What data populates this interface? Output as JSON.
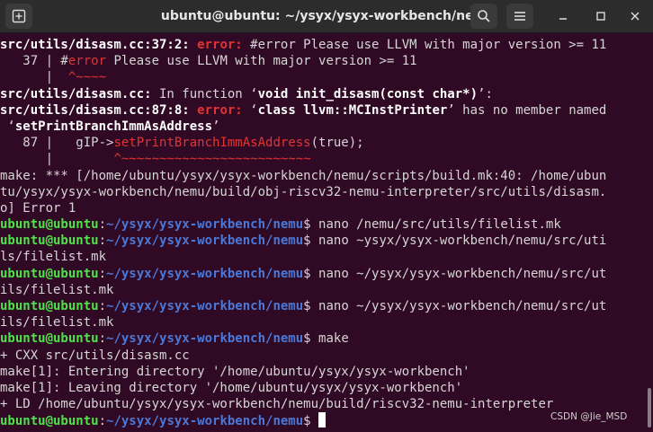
{
  "window": {
    "title": "ubuntu@ubuntu: ~/ysyx/ysyx-workbench/nemu",
    "icons": {
      "new_tab": "new-tab-icon",
      "search": "search-icon",
      "menu": "hamburger-menu-icon",
      "minimize": "minimize-icon",
      "maximize": "maximize-icon",
      "close": "close-icon"
    }
  },
  "colors": {
    "background": "#300a24",
    "error": "#e23434",
    "user": "#4fe34a",
    "path": "#4a78d8",
    "text": "#d6d6d6"
  },
  "terminal": {
    "lines": [
      [
        {
          "t": "src/utils/disasm.cc:37:2: ",
          "c": "b"
        },
        {
          "t": "error: ",
          "c": "err"
        },
        {
          "t": "#error Please use LLVM with major version >= 11",
          "c": ""
        }
      ],
      [
        {
          "t": "   37 | #",
          "c": ""
        },
        {
          "t": "error",
          "c": "errn"
        },
        {
          "t": " Please use LLVM with major version >= 11",
          "c": ""
        }
      ],
      [
        {
          "t": "      |  ",
          "c": ""
        },
        {
          "t": "^~~~~",
          "c": "errn"
        }
      ],
      [
        {
          "t": "src/utils/disasm.cc:",
          "c": "b"
        },
        {
          "t": " In function ‘",
          "c": ""
        },
        {
          "t": "void init_disasm(const char*)",
          "c": "b"
        },
        {
          "t": "’:",
          "c": ""
        }
      ],
      [
        {
          "t": "src/utils/disasm.cc:87:8: ",
          "c": "b"
        },
        {
          "t": "error: ",
          "c": "err"
        },
        {
          "t": "‘",
          "c": ""
        },
        {
          "t": "class llvm::MCInstPrinter",
          "c": "b"
        },
        {
          "t": "’ has no member named",
          "c": ""
        }
      ],
      [
        {
          "t": " ‘",
          "c": ""
        },
        {
          "t": "setPrintBranchImmAsAddress",
          "c": "b"
        },
        {
          "t": "’",
          "c": ""
        }
      ],
      [
        {
          "t": "   87 |   gIP->",
          "c": ""
        },
        {
          "t": "setPrintBranchImmAsAddress",
          "c": "errn"
        },
        {
          "t": "(true);",
          "c": ""
        }
      ],
      [
        {
          "t": "      |        ",
          "c": ""
        },
        {
          "t": "^~~~~~~~~~~~~~~~~~~~~~~~~~",
          "c": "errn"
        }
      ],
      [
        {
          "t": "make: *** [/home/ubuntu/ysyx/ysyx-workbench/nemu/scripts/build.mk:40: /home/ubun",
          "c": ""
        }
      ],
      [
        {
          "t": "tu/ysyx/ysyx-workbench/nemu/build/obj-riscv32-nemu-interpreter/src/utils/disasm.",
          "c": ""
        }
      ],
      [
        {
          "t": "o] Error 1",
          "c": ""
        }
      ],
      [
        {
          "t": "ubuntu@ubuntu",
          "c": "usr"
        },
        {
          "t": ":",
          "c": ""
        },
        {
          "t": "~/ysyx/ysyx-workbench/nemu",
          "c": "path"
        },
        {
          "t": "$ nano /nemu/src/utils/filelist.mk",
          "c": ""
        }
      ],
      [
        {
          "t": "ubuntu@ubuntu",
          "c": "usr"
        },
        {
          "t": ":",
          "c": ""
        },
        {
          "t": "~/ysyx/ysyx-workbench/nemu",
          "c": "path"
        },
        {
          "t": "$ nano ~ysyx/ysyx-workbench/nemu/src/uti",
          "c": ""
        }
      ],
      [
        {
          "t": "ls/filelist.mk",
          "c": ""
        }
      ],
      [
        {
          "t": "ubuntu@ubuntu",
          "c": "usr"
        },
        {
          "t": ":",
          "c": ""
        },
        {
          "t": "~/ysyx/ysyx-workbench/nemu",
          "c": "path"
        },
        {
          "t": "$ nano ~/ysyx/ysyx-workbench/nemu/src/ut",
          "c": ""
        }
      ],
      [
        {
          "t": "ils/filelist.mk",
          "c": ""
        }
      ],
      [
        {
          "t": "ubuntu@ubuntu",
          "c": "usr"
        },
        {
          "t": ":",
          "c": ""
        },
        {
          "t": "~/ysyx/ysyx-workbench/nemu",
          "c": "path"
        },
        {
          "t": "$ nano ~/ysyx/ysyx-workbench/nemu/src/ut",
          "c": ""
        }
      ],
      [
        {
          "t": "ils/filelist.mk",
          "c": ""
        }
      ],
      [
        {
          "t": "ubuntu@ubuntu",
          "c": "usr"
        },
        {
          "t": ":",
          "c": ""
        },
        {
          "t": "~/ysyx/ysyx-workbench/nemu",
          "c": "path"
        },
        {
          "t": "$ make",
          "c": ""
        }
      ],
      [
        {
          "t": "+ CXX src/utils/disasm.cc",
          "c": ""
        }
      ],
      [
        {
          "t": "make[1]: Entering directory '/home/ubuntu/ysyx/ysyx-workbench'",
          "c": ""
        }
      ],
      [
        {
          "t": "make[1]: Leaving directory '/home/ubuntu/ysyx/ysyx-workbench'",
          "c": ""
        }
      ],
      [
        {
          "t": "+ LD /home/ubuntu/ysyx/ysyx-workbench/nemu/build/riscv32-nemu-interpreter",
          "c": ""
        }
      ],
      [
        {
          "t": "ubuntu@ubuntu",
          "c": "usr"
        },
        {
          "t": ":",
          "c": ""
        },
        {
          "t": "~/ysyx/ysyx-workbench/nemu",
          "c": "path"
        },
        {
          "t": "$ ",
          "c": ""
        }
      ]
    ]
  },
  "watermark": "CSDN @Jie_MSD"
}
